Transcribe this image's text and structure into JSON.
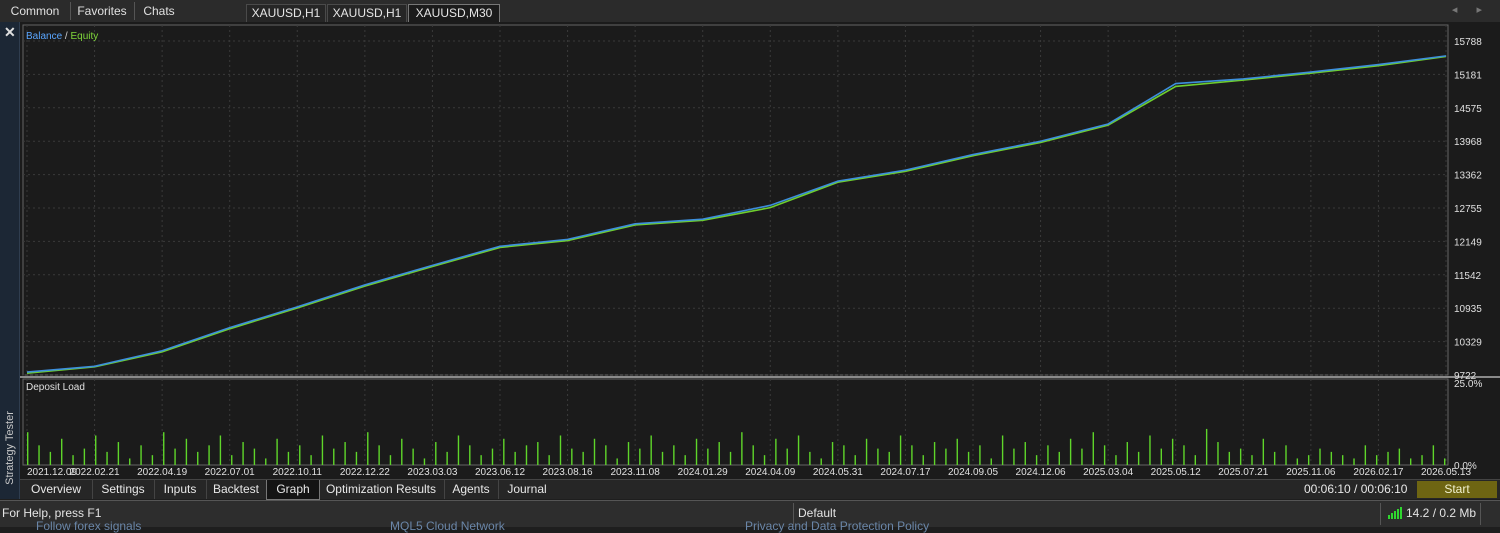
{
  "top_tabs": [
    "Common",
    "Favorites",
    "Chats"
  ],
  "chart_tabs": [
    "XAUUSD,H1",
    "XAUUSD,H1",
    "XAUUSD,M30"
  ],
  "active_chart_tab": 2,
  "nav_arrows": "◂ ▸",
  "side_panel": {
    "close_icon": "✕",
    "label": "Strategy Tester"
  },
  "chart": {
    "legend_balance": "Balance",
    "legend_sep": " / ",
    "legend_equity": "Equity",
    "deposit_title": "Deposit Load",
    "colors": {
      "balance": "#3d8fdc",
      "equity": "#6fcf2e",
      "deposit_bars": "#5fd62a",
      "grid": "#3a3a3a",
      "background": "#1b1b1b"
    }
  },
  "chart_data": [
    {
      "type": "line",
      "title": "",
      "series": [
        {
          "name": "Balance",
          "x": [
            "2021.12.09",
            "2022.02.21",
            "2022.04.19",
            "2022.07.01",
            "2022.10.11",
            "2022.12.22",
            "2023.03.03",
            "2023.06.12",
            "2023.08.16",
            "2023.11.08",
            "2024.01.29",
            "2024.04.09",
            "2024.05.31",
            "2024.07.17",
            "2024.09.05",
            "2024.12.06",
            "2025.03.04",
            "2025.05.12",
            "2025.07.21",
            "2025.11.06",
            "2026.02.17",
            "2026.05.13"
          ],
          "y": [
            10050,
            10150,
            10420,
            10820,
            11180,
            11560,
            11900,
            12230,
            12350,
            12620,
            12700,
            12940,
            13360,
            13550,
            13820,
            14050,
            14350,
            15050,
            15130,
            15250,
            15380,
            15530
          ]
        },
        {
          "name": "Equity",
          "x": [
            "2021.12.09",
            "2022.02.21",
            "2022.04.19",
            "2022.07.01",
            "2022.10.11",
            "2022.12.22",
            "2023.03.03",
            "2023.06.12",
            "2023.08.16",
            "2023.11.08",
            "2024.01.29",
            "2024.04.09",
            "2024.05.31",
            "2024.07.17",
            "2024.09.05",
            "2024.12.06",
            "2025.03.04",
            "2025.05.12",
            "2025.07.21",
            "2025.11.06",
            "2026.02.17",
            "2026.05.13"
          ],
          "y": [
            10030,
            10140,
            10400,
            10800,
            11160,
            11540,
            11880,
            12210,
            12330,
            12600,
            12680,
            12900,
            13340,
            13530,
            13800,
            14030,
            14330,
            15000,
            15110,
            15230,
            15360,
            15520
          ]
        }
      ],
      "y_ticks": [
        15788,
        15181,
        14575,
        13968,
        13362,
        12755,
        12149,
        11542,
        10935,
        10329,
        9722
      ],
      "ylim": [
        9722,
        15788
      ],
      "grid": true
    },
    {
      "type": "bar",
      "title": "Deposit Load",
      "y_ticks": [
        "25.0%",
        "0.0%"
      ],
      "ylim": [
        0,
        25
      ],
      "x_ticks": [
        "2021.12.09",
        "2022.02.21",
        "2022.04.19",
        "2022.07.01",
        "2022.10.11",
        "2022.12.22",
        "2023.03.03",
        "2023.06.12",
        "2023.08.16",
        "2023.11.08",
        "2024.01.29",
        "2024.04.09",
        "2024.05.31",
        "2024.07.17",
        "2024.09.05",
        "2024.12.06",
        "2025.03.04",
        "2025.05.12",
        "2025.07.21",
        "2025.11.06",
        "2026.02.17",
        "2026.05.13"
      ],
      "values": [
        10,
        6,
        4,
        8,
        3,
        5,
        9,
        4,
        7,
        2,
        6,
        3,
        10,
        5,
        8,
        4,
        6,
        9,
        3,
        7,
        5,
        2,
        8,
        4,
        6,
        3,
        9,
        5,
        7,
        4,
        10,
        6,
        3,
        8,
        5,
        2,
        7,
        4,
        9,
        6,
        3,
        5,
        8,
        4,
        6,
        7,
        3,
        9,
        5,
        4,
        8,
        6,
        2,
        7,
        5,
        9,
        4,
        6,
        3,
        8,
        5,
        7,
        4,
        10,
        6,
        3,
        8,
        5,
        9,
        4,
        2,
        7,
        6,
        3,
        8,
        5,
        4,
        9,
        6,
        3,
        7,
        5,
        8,
        4,
        6,
        2,
        9,
        5,
        7,
        3,
        6,
        4,
        8,
        5,
        10,
        6,
        3,
        7,
        4,
        9,
        5,
        8,
        6,
        3,
        11,
        7,
        4,
        5,
        3,
        8,
        4,
        6,
        2,
        3,
        5,
        4,
        3,
        2,
        6,
        3,
        4,
        5,
        2,
        3,
        6,
        2
      ]
    }
  ],
  "bottom_tabs": [
    "Overview",
    "Settings",
    "Inputs",
    "Backtest",
    "Graph",
    "Optimization Results",
    "Agents",
    "Journal"
  ],
  "active_bottom_tab": 4,
  "timer": "00:06:10 / 00:06:10",
  "start_label": "Start",
  "status": {
    "help": "For Help, press F1",
    "profile": "Default",
    "traffic": "14.2 / 0.2 Mb"
  },
  "ghost_links": [
    "Follow forex signals",
    "MQL5 Cloud Network",
    "Privacy and Data Protection Policy"
  ]
}
